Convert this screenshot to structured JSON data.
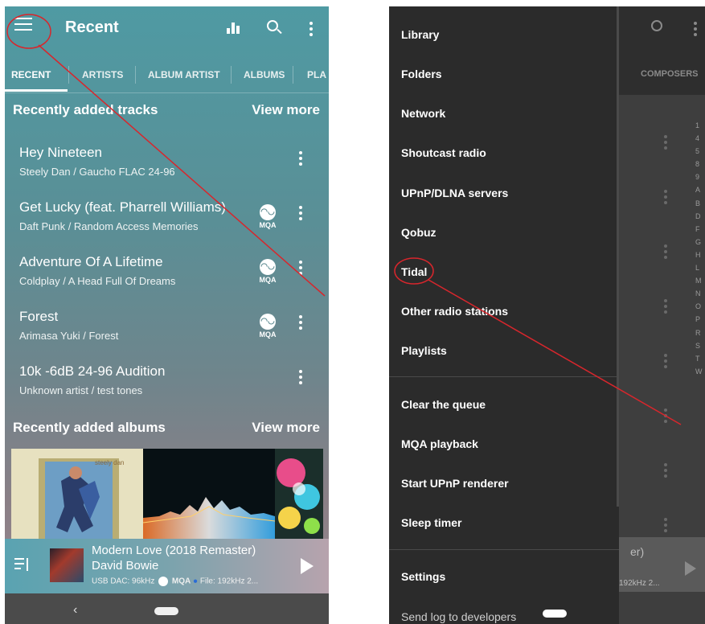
{
  "left": {
    "appbar": {
      "title": "Recent"
    },
    "tabs": [
      "RECENT",
      "ARTISTS",
      "ALBUM ARTIST",
      "ALBUMS",
      "PLA"
    ],
    "recent_tracks": {
      "title": "Recently added tracks",
      "view_more": "View more",
      "items": [
        {
          "title": "Hey Nineteen",
          "subtitle": "Steely Dan / Gaucho FLAC 24-96",
          "mqa": false
        },
        {
          "title": "Get Lucky (feat. Pharrell Williams)",
          "subtitle": "Daft Punk / Random Access Memories",
          "mqa": true
        },
        {
          "title": "Adventure Of A Lifetime",
          "subtitle": "Coldplay / A Head Full Of Dreams",
          "mqa": true
        },
        {
          "title": "Forest",
          "subtitle": "Arimasa Yuki / Forest",
          "mqa": true
        },
        {
          "title": "10k -6dB 24-96 Audition",
          "subtitle": "Unknown artist / test tones",
          "mqa": false
        }
      ],
      "mqa_label": "MQA"
    },
    "recent_albums": {
      "title": "Recently added albums",
      "view_more": "View more",
      "album1_text": "steely dan"
    },
    "now_playing": {
      "title": "Modern Love (2018 Remaster)",
      "artist": "David Bowie",
      "info_dac": "USB DAC: 96kHz",
      "info_mqa": "MQA",
      "info_file": "File: 192kHz  2..."
    },
    "nav": {
      "back": "‹"
    }
  },
  "right": {
    "drawer": {
      "items": [
        "Library",
        "Folders",
        "Network",
        "Shoutcast radio",
        "UPnP/DLNA servers",
        "Qobuz",
        "Tidal",
        "Other radio stations",
        "Playlists"
      ],
      "actions": [
        "Clear the queue",
        "MQA playback",
        "Start UPnP renderer",
        "Sleep timer"
      ],
      "settings": [
        "Settings",
        "Send log to developers"
      ]
    },
    "background": {
      "tab": "COMPOSERS",
      "index": [
        "1",
        "4",
        "5",
        "8",
        "9",
        "A",
        "B",
        "D",
        "F",
        "G",
        "H",
        "L",
        "M",
        "N",
        "O",
        "P",
        "R",
        "S",
        "T",
        "W"
      ],
      "player_text": "er)",
      "player_hz": "192kHz  2..."
    },
    "nav": {
      "back": "‹"
    }
  },
  "colors": {
    "annotation": "#d8262c"
  }
}
